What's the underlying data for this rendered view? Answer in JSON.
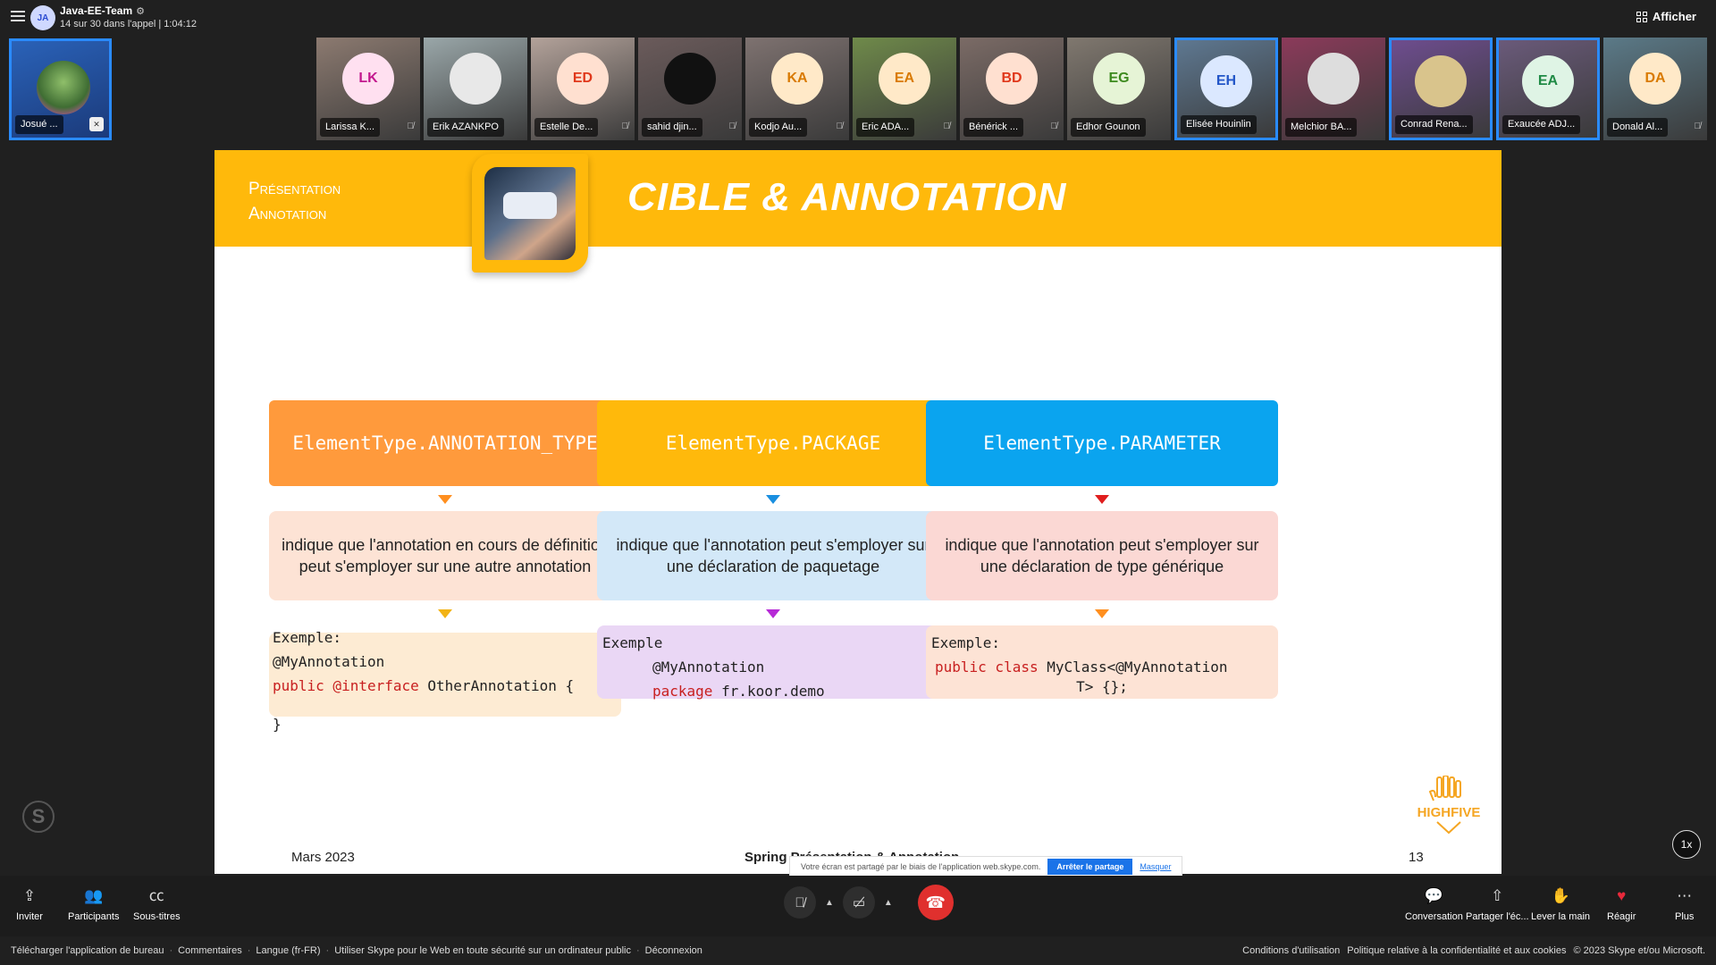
{
  "call": {
    "avatar_initials": "JA",
    "title": "Java-EE-Team",
    "subtitle": "14 sur 30 dans l'appel | 1:04:12",
    "afficher_label": "Afficher"
  },
  "self_tile": {
    "name": "Josué ..."
  },
  "participants": [
    {
      "initials": "LK",
      "name": "Larissa K...",
      "bg": "#ffe0f0",
      "fg": "#c2188d",
      "tile": "#8c7a70",
      "muted": true,
      "photo": false
    },
    {
      "initials": "",
      "name": "Erik AZANKPO",
      "bg": "#e8e8e8",
      "fg": "#333",
      "tile": "#9aa7a9",
      "muted": false,
      "photo": true
    },
    {
      "initials": "ED",
      "name": "Estelle De...",
      "bg": "#ffe0d0",
      "fg": "#e0381b",
      "tile": "#b3a29a",
      "muted": true,
      "photo": false
    },
    {
      "initials": "",
      "name": "sahid djin...",
      "bg": "#111",
      "fg": "#fff",
      "tile": "#6b5b5b",
      "muted": true,
      "photo": true
    },
    {
      "initials": "KA",
      "name": "Kodjo Au...",
      "bg": "#ffe9c8",
      "fg": "#d97a00",
      "tile": "#7e7270",
      "muted": true,
      "photo": false
    },
    {
      "initials": "EA",
      "name": "Eric ADA...",
      "bg": "#ffe9c8",
      "fg": "#d97a00",
      "tile": "#6f8a4a",
      "muted": true,
      "photo": false
    },
    {
      "initials": "BD",
      "name": "Bénérick ...",
      "bg": "#ffe0d0",
      "fg": "#e0381b",
      "tile": "#7b6b66",
      "muted": true,
      "photo": false
    },
    {
      "initials": "EG",
      "name": "Edhor Gounon",
      "bg": "#e6f4d6",
      "fg": "#3d8a1e",
      "tile": "#80786f",
      "muted": false,
      "photo": false
    },
    {
      "initials": "EH",
      "name": "Elisée Houinlin",
      "bg": "#dbe8ff",
      "fg": "#2356c8",
      "tile": "#5e7891",
      "muted": false,
      "photo": false,
      "selected": true
    },
    {
      "initials": "",
      "name": "Melchior BA...",
      "bg": "#ddd",
      "fg": "#333",
      "tile": "#8b3a5a",
      "muted": false,
      "photo": true
    },
    {
      "initials": "",
      "name": "Conrad Rena...",
      "bg": "#d9c48c",
      "fg": "#333",
      "tile": "#6e4d8f",
      "muted": false,
      "photo": true,
      "selected": true
    },
    {
      "initials": "EA",
      "name": "Exaucée ADJ...",
      "bg": "#dff4e5",
      "fg": "#1f8a45",
      "tile": "#6a5a7a",
      "muted": false,
      "photo": false,
      "selected": true
    },
    {
      "initials": "DA",
      "name": "Donald Al...",
      "bg": "#ffe9c8",
      "fg": "#d97a00",
      "tile": "#5b7a88",
      "muted": true,
      "photo": false
    }
  ],
  "slide": {
    "breadcrumb_1": "Présentation",
    "breadcrumb_2": "Annotation",
    "title": "CIBLE & ANNOTATION",
    "columns": [
      {
        "type": "ElementType.ANNOTATION_TYPE",
        "type_color": "#ff9a3c",
        "arrow1_color": "#ff8f1f",
        "desc": "indique que l'annotation en cours de définition peut s'employer sur une autre annotation",
        "desc_bg": "#fde3d5",
        "arrow2_color": "#f2b316",
        "ex_label": "Exemple:",
        "ex_line1": "@MyAnnotation",
        "ex_kw": "public @interface",
        "ex_rest": " OtherAnnotation {",
        "ex_close": "}",
        "ex_bg": "#fdebd3"
      },
      {
        "type": "ElementType.PACKAGE",
        "type_color": "#ffb90b",
        "arrow1_color": "#1a8fe0",
        "desc": "indique que l'annotation peut s'employer sur une déclaration de paquetage",
        "desc_bg": "#d3e8f8",
        "arrow2_color": "#b62ad6",
        "ex_label": "Exemple",
        "ex_line1": "@MyAnnotation",
        "ex_kw": "package",
        "ex_rest": " fr.koor.demo",
        "ex_bg": "#ead7f5"
      },
      {
        "type": "ElementType.PARAMETER",
        "type_color": "#0aa4ef",
        "arrow1_color": "#e01e1e",
        "desc": "indique que l'annotation peut s'employer sur une déclaration de type générique",
        "desc_bg": "#fbd8d4",
        "arrow2_color": "#ff8f1f",
        "ex_label": "Exemple:",
        "ex_kw": "public class",
        "ex_rest": " MyClass<@MyAnnotation",
        "ex_line2": "T> {};",
        "ex_bg": "#fde3d5"
      }
    ],
    "footer_date": "Mars 2023",
    "footer_mid": "Spring Présentation & Annotation",
    "page_number": "13",
    "logo_text": "HIGHFIVE"
  },
  "share_bar": {
    "message": "Votre écran est partagé par le biais de l'application web.skype.com.",
    "stop": "Arrêter le partage",
    "hide": "Masquer"
  },
  "speed": "1x",
  "controls": {
    "invite": "Inviter",
    "participants": "Participants",
    "captions": "Sous-titres",
    "conversation": "Conversation",
    "share": "Partager l'éc...",
    "raise_hand": "Lever la main",
    "react": "Réagir",
    "more": "Plus"
  },
  "footer_links": {
    "left": [
      "Télécharger l'application de bureau",
      "Commentaires",
      "Langue (fr-FR)",
      "Utiliser Skype pour le Web en toute sécurité sur un ordinateur public",
      "Déconnexion"
    ],
    "terms": "Conditions d'utilisation",
    "privacy": "Politique relative à la confidentialité et aux cookies",
    "copyright": "© 2023 Skype et/ou Microsoft."
  }
}
